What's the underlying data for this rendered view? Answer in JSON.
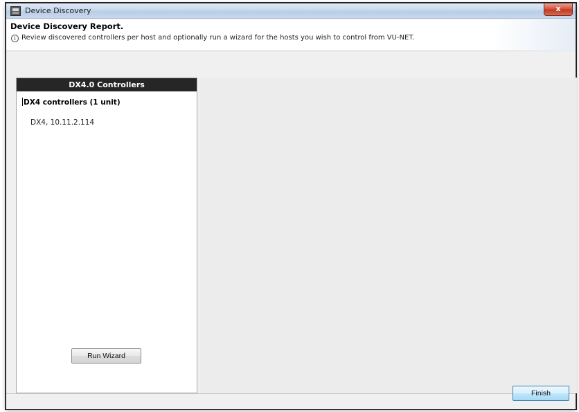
{
  "window": {
    "title": "Device Discovery",
    "close_label": "x"
  },
  "header": {
    "title": "Device Discovery Report.",
    "info_glyph": "i",
    "message": "Review discovered controllers per host and optionally run a wizard for the hosts you wish to control from VU-NET."
  },
  "left_panel": {
    "header": "DX4.0 Controllers",
    "group_label": "DX4 controllers (1 unit)",
    "items": [
      {
        "label": "DX4, 10.11.2.114"
      }
    ],
    "run_wizard_label": "Run Wizard"
  },
  "footer": {
    "finish_label": "Finish"
  },
  "colors": {
    "panel_header_bg": "#262626",
    "window_bg": "#f0f0f0",
    "close_button": "#c23a23",
    "finish_border": "#3c7fb1"
  }
}
